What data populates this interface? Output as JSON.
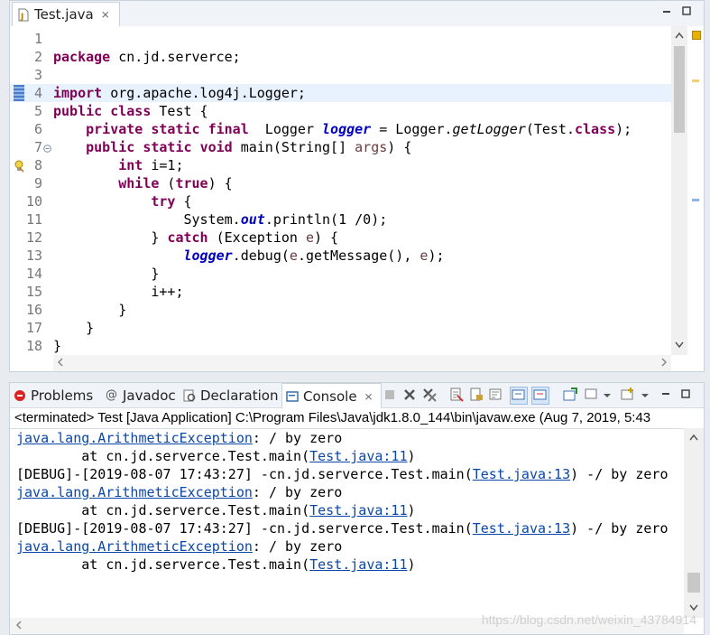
{
  "editor": {
    "tab_label": "Test.java",
    "tab_close": "⨯",
    "lines": [
      {
        "n": "1",
        "segments": []
      },
      {
        "n": "2",
        "segments": [
          {
            "t": "kw",
            "v": "package"
          },
          {
            "t": "plain",
            "v": " cn.jd.serverce;"
          }
        ]
      },
      {
        "n": "3",
        "segments": []
      },
      {
        "n": "4",
        "current": true,
        "marker": "bookmark",
        "segments": [
          {
            "t": "kw",
            "v": "import"
          },
          {
            "t": "plain",
            "v": " org.apache.log4j.Logger;"
          }
        ]
      },
      {
        "n": "5",
        "segments": [
          {
            "t": "kw",
            "v": "public"
          },
          {
            "t": "plain",
            "v": " "
          },
          {
            "t": "kw",
            "v": "class"
          },
          {
            "t": "plain",
            "v": " Test {"
          }
        ]
      },
      {
        "n": "6",
        "segments": [
          {
            "t": "plain",
            "v": "    "
          },
          {
            "t": "kw",
            "v": "private"
          },
          {
            "t": "plain",
            "v": " "
          },
          {
            "t": "kw",
            "v": "static"
          },
          {
            "t": "plain",
            "v": " "
          },
          {
            "t": "kw",
            "v": "final"
          },
          {
            "t": "plain",
            "v": "  Logger "
          },
          {
            "t": "field",
            "v": "logger"
          },
          {
            "t": "plain",
            "v": " = Logger."
          },
          {
            "t": "smethod",
            "v": "getLogger"
          },
          {
            "t": "plain",
            "v": "(Test."
          },
          {
            "t": "kw",
            "v": "class"
          },
          {
            "t": "plain",
            "v": ");"
          }
        ]
      },
      {
        "n": "7",
        "fold": true,
        "segments": [
          {
            "t": "plain",
            "v": "    "
          },
          {
            "t": "kw",
            "v": "public"
          },
          {
            "t": "plain",
            "v": " "
          },
          {
            "t": "kw",
            "v": "static"
          },
          {
            "t": "plain",
            "v": " "
          },
          {
            "t": "kw",
            "v": "void"
          },
          {
            "t": "plain",
            "v": " main(String[] "
          },
          {
            "t": "param",
            "v": "args"
          },
          {
            "t": "plain",
            "v": ") {"
          }
        ]
      },
      {
        "n": "8",
        "marker": "warning",
        "segments": [
          {
            "t": "plain",
            "v": "        "
          },
          {
            "t": "kw",
            "v": "int"
          },
          {
            "t": "plain",
            "v": " i=1;"
          }
        ]
      },
      {
        "n": "9",
        "segments": [
          {
            "t": "plain",
            "v": "        "
          },
          {
            "t": "kw",
            "v": "while"
          },
          {
            "t": "plain",
            "v": " ("
          },
          {
            "t": "kw",
            "v": "true"
          },
          {
            "t": "plain",
            "v": ") {"
          }
        ]
      },
      {
        "n": "10",
        "segments": [
          {
            "t": "plain",
            "v": "            "
          },
          {
            "t": "kw",
            "v": "try"
          },
          {
            "t": "plain",
            "v": " {"
          }
        ]
      },
      {
        "n": "11",
        "segments": [
          {
            "t": "plain",
            "v": "                System."
          },
          {
            "t": "field",
            "v": "out"
          },
          {
            "t": "plain",
            "v": ".println(1 /0);"
          }
        ]
      },
      {
        "n": "12",
        "segments": [
          {
            "t": "plain",
            "v": "            } "
          },
          {
            "t": "kw",
            "v": "catch"
          },
          {
            "t": "plain",
            "v": " (Exception "
          },
          {
            "t": "param",
            "v": "e"
          },
          {
            "t": "plain",
            "v": ") {"
          }
        ]
      },
      {
        "n": "13",
        "segments": [
          {
            "t": "plain",
            "v": "                "
          },
          {
            "t": "field",
            "v": "logger"
          },
          {
            "t": "plain",
            "v": ".debug("
          },
          {
            "t": "param",
            "v": "e"
          },
          {
            "t": "plain",
            "v": ".getMessage(), "
          },
          {
            "t": "param",
            "v": "e"
          },
          {
            "t": "plain",
            "v": ");"
          }
        ]
      },
      {
        "n": "14",
        "segments": [
          {
            "t": "plain",
            "v": "            }"
          }
        ]
      },
      {
        "n": "15",
        "segments": [
          {
            "t": "plain",
            "v": "            i++;"
          }
        ]
      },
      {
        "n": "16",
        "segments": [
          {
            "t": "plain",
            "v": "        }"
          }
        ]
      },
      {
        "n": "17",
        "segments": [
          {
            "t": "plain",
            "v": "    }"
          }
        ]
      },
      {
        "n": "18",
        "segments": [
          {
            "t": "plain",
            "v": "}"
          }
        ]
      }
    ]
  },
  "console_panel": {
    "tabs": [
      {
        "label": "Problems",
        "icon": "problems-icon"
      },
      {
        "label": "Javadoc",
        "icon": "at-icon"
      },
      {
        "label": "Declaration",
        "icon": "declaration-icon"
      },
      {
        "label": "Console",
        "icon": "console-icon",
        "active": true
      }
    ],
    "tab_close": "⨯",
    "header": "<terminated> Test [Java Application] C:\\Program Files\\Java\\jdk1.8.0_144\\bin\\javaw.exe (Aug 7, 2019, 5:43",
    "lines": [
      [
        {
          "t": "link",
          "v": "java.lang.ArithmeticException"
        },
        {
          "t": "plain",
          "v": ": / by zero"
        }
      ],
      [
        {
          "t": "plain",
          "v": "\tat cn.jd.serverce.Test.main("
        },
        {
          "t": "link",
          "v": "Test.java:11"
        },
        {
          "t": "plain",
          "v": ")"
        }
      ],
      [
        {
          "t": "plain",
          "v": "[DEBUG]-[2019-08-07 17:43:27] -cn.jd.serverce.Test.main("
        },
        {
          "t": "link",
          "v": "Test.java:13"
        },
        {
          "t": "plain",
          "v": ") -/ by zero"
        }
      ],
      [
        {
          "t": "link",
          "v": "java.lang.ArithmeticException"
        },
        {
          "t": "plain",
          "v": ": / by zero"
        }
      ],
      [
        {
          "t": "plain",
          "v": "\tat cn.jd.serverce.Test.main("
        },
        {
          "t": "link",
          "v": "Test.java:11"
        },
        {
          "t": "plain",
          "v": ")"
        }
      ],
      [
        {
          "t": "plain",
          "v": "[DEBUG]-[2019-08-07 17:43:27] -cn.jd.serverce.Test.main("
        },
        {
          "t": "link",
          "v": "Test.java:13"
        },
        {
          "t": "plain",
          "v": ") -/ by zero"
        }
      ],
      [
        {
          "t": "link",
          "v": "java.lang.ArithmeticException"
        },
        {
          "t": "plain",
          "v": ": / by zero"
        }
      ],
      [
        {
          "t": "plain",
          "v": "\tat cn.jd.serverce.Test.main("
        },
        {
          "t": "link",
          "v": "Test.java:11"
        },
        {
          "t": "plain",
          "v": ")"
        }
      ]
    ]
  },
  "watermark": "https://blog.csdn.net/weixin_43784914"
}
